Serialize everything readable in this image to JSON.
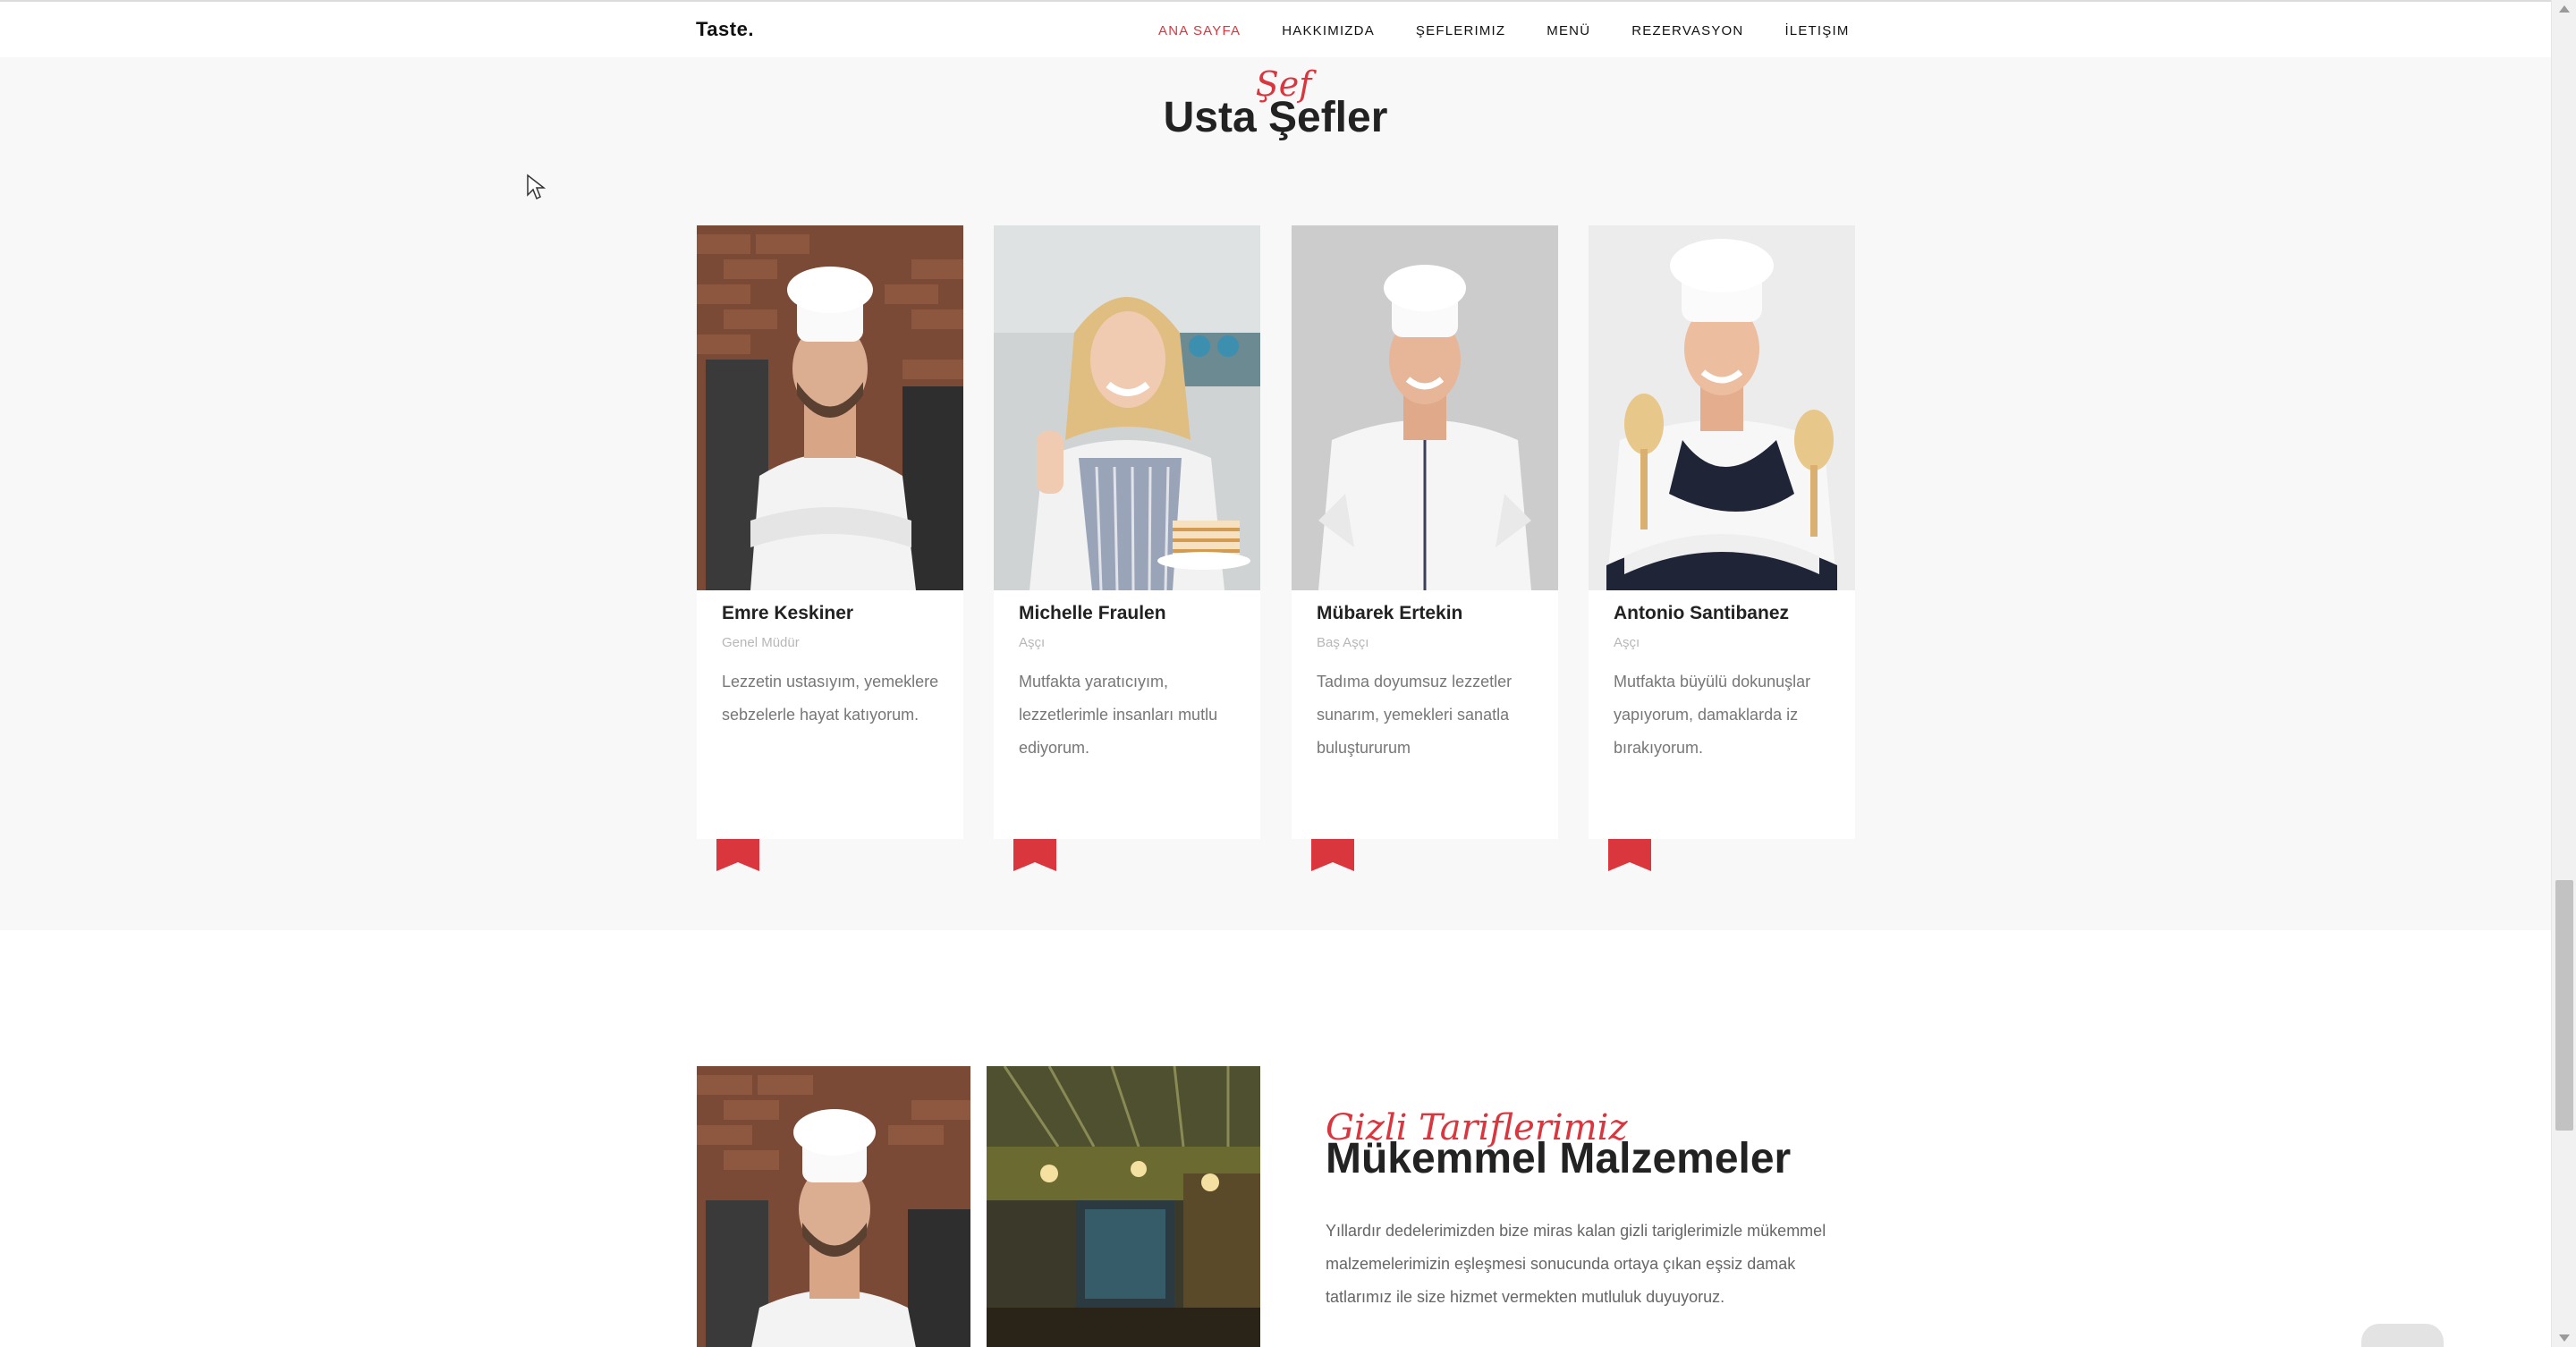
{
  "brand": "Taste.",
  "nav": [
    {
      "label": "ANA SAYFA",
      "active": true
    },
    {
      "label": "HAKKIMIZDA",
      "active": false
    },
    {
      "label": "ŞEFLERIMIZ",
      "active": false
    },
    {
      "label": "MENÜ",
      "active": false
    },
    {
      "label": "REZERVASYON",
      "active": false
    },
    {
      "label": "İLETIŞIM",
      "active": false
    }
  ],
  "chefs_section": {
    "subtitle": "Şef",
    "title": "Usta Şefler",
    "chefs": [
      {
        "name": "Emre Keskiner",
        "role": "Genel Müdür",
        "description": "Lezzetin ustasıyım, yemeklere sebzelerle hayat katıyorum."
      },
      {
        "name": "Michelle Fraulen",
        "role": "Aşçı",
        "description": "Mutfakta yaratıcıyım, lezzetlerimle insanları mutlu ediyorum."
      },
      {
        "name": "Mübarek Ertekin",
        "role": "Baş Aşçı",
        "description": "Tadıma doyumsuz lezzetler sunarım, yemekleri sanatla buluştururum"
      },
      {
        "name": "Antonio Santibanez",
        "role": "Aşçı",
        "description": "Mutfakta büyülü dokunuşlar yapıyorum, damaklarda iz bırakıyorum."
      }
    ]
  },
  "ingredients_section": {
    "subtitle": "Gizli Tariflerimiz",
    "title": "Mükemmel Malzemeler",
    "text": "Yıllardır dedelerimizden bize miras kalan gizli tariglerimizle mükemmel malzemelerimizin eşleşmesi sonucunda ortaya çıkan eşsiz damak tatlarımız ile size hizmet vermekten mutluluk duyuyoruz."
  },
  "colors": {
    "accent": "#d9363e",
    "background": "#f8f8f8"
  }
}
